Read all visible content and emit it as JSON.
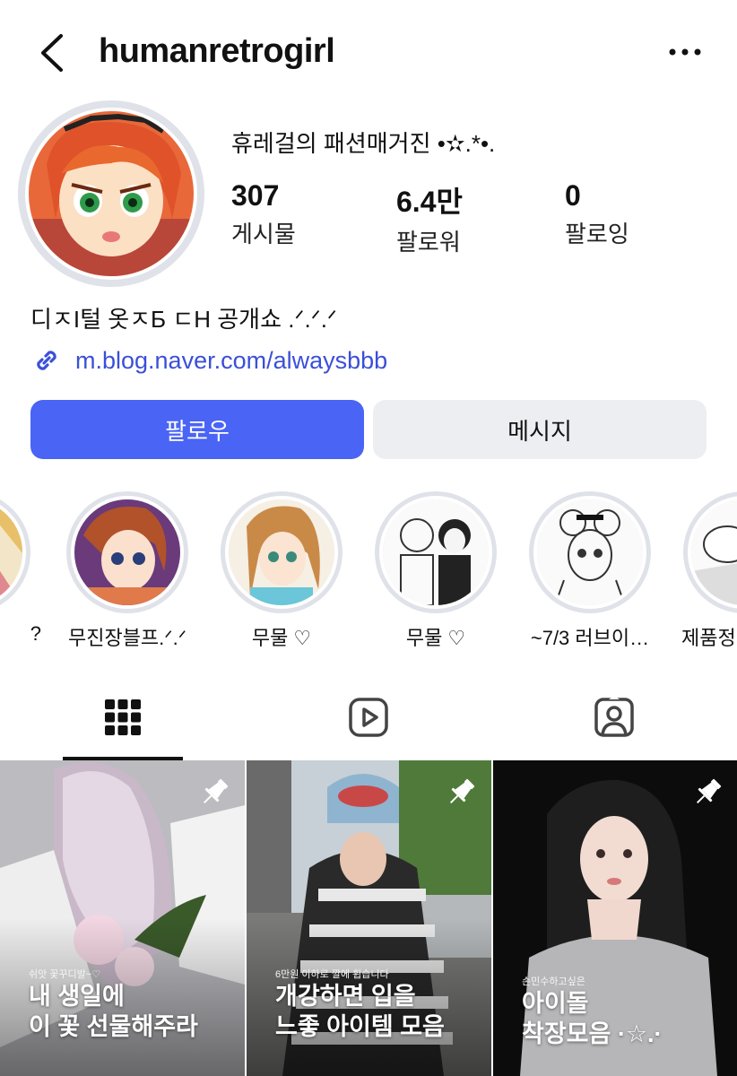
{
  "header": {
    "username": "humanretrogirl"
  },
  "profile": {
    "display_name": "휴레걸의 패션매거진 •✫.*•.",
    "stats": [
      {
        "value": "307",
        "label": "게시물"
      },
      {
        "value": "6.4만",
        "label": "팔로워"
      },
      {
        "value": "0",
        "label": "팔로잉"
      }
    ],
    "bio": "디ㅈI털 옷ㅈБ ㄷH 공개쇼 .ᐟ.ᐟ.ᐟ",
    "link": "m.blog.naver.com/alwaysbbb"
  },
  "buttons": {
    "follow": "팔로우",
    "message": "메시지"
  },
  "highlights": [
    {
      "label": "?"
    },
    {
      "label": "무진장블프.ᐟ.ᐟ"
    },
    {
      "label": "무물 ♡"
    },
    {
      "label": "무물 ♡"
    },
    {
      "label": "~7/3 러브이…"
    },
    {
      "label": "제품정"
    }
  ],
  "tabs": [
    "grid-icon",
    "reels-icon",
    "tagged-icon"
  ],
  "posts": [
    {
      "small": "쉬앗 꽃꾸디발~♡",
      "line1": "내 생일에",
      "line2": "이 꽃 선물해주라",
      "pinned": true
    },
    {
      "small": "6만원 이하로 깔에 휩습니다",
      "line1": "개강하면 입을",
      "line2": "느좋 아이템 모음",
      "pinned": true
    },
    {
      "small": "손민수하고싶은",
      "line1": "아이돌",
      "line2": "착장모음 ·☆.·",
      "pinned": true
    }
  ],
  "colors": {
    "accent": "#4a64f5",
    "link": "#3b4fd8",
    "secondary_button": "#eceef2"
  }
}
